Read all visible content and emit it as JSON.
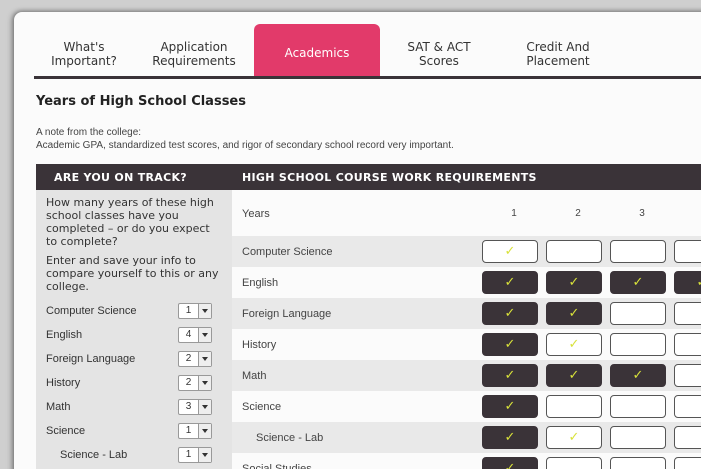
{
  "tabs": [
    {
      "label": "What's\nImportant?",
      "active": false
    },
    {
      "label": "Application\nRequirements",
      "active": false
    },
    {
      "label": "Academics",
      "active": true
    },
    {
      "label": "SAT & ACT\nScores",
      "active": false
    },
    {
      "label": "Credit And\nPlacement",
      "active": false
    }
  ],
  "section_title": "Years of High School Classes",
  "note": {
    "heading": "A note from the college:",
    "text": "Academic GPA, standardized test scores, and rigor of secondary school record very important."
  },
  "header": {
    "left": "ARE YOU ON TRACK?",
    "right": "HIGH SCHOOL COURSE WORK REQUIREMENTS"
  },
  "left_panel": {
    "question": "How many years of these high school classes have you completed – or do you expect to complete?",
    "enter": "Enter and save your info to compare yourself to this or any college.",
    "subjects": [
      {
        "label": "Computer Science",
        "value": "1"
      },
      {
        "label": "English",
        "value": "4"
      },
      {
        "label": "Foreign Language",
        "value": "2"
      },
      {
        "label": "History",
        "value": "2"
      },
      {
        "label": "Math",
        "value": "3"
      },
      {
        "label": "Science",
        "value": "1"
      },
      {
        "label": "Science - Lab",
        "value": "1"
      }
    ]
  },
  "grid": {
    "years_label": "Years",
    "year_numbers": [
      "1",
      "2",
      "3"
    ],
    "rows": [
      {
        "label": "Computer Science",
        "cells": [
          "empty-check",
          "empty",
          "empty",
          "empty"
        ]
      },
      {
        "label": "English",
        "cells": [
          "filled",
          "filled",
          "filled",
          "filled"
        ]
      },
      {
        "label": "Foreign Language",
        "cells": [
          "filled",
          "filled",
          "empty",
          "empty"
        ]
      },
      {
        "label": "History",
        "cells": [
          "filled",
          "empty-check",
          "empty",
          "empty"
        ]
      },
      {
        "label": "Math",
        "cells": [
          "filled",
          "filled",
          "filled",
          "empty"
        ]
      },
      {
        "label": "Science",
        "cells": [
          "filled",
          "empty",
          "empty",
          "empty"
        ]
      },
      {
        "label": "Science - Lab",
        "cells": [
          "filled",
          "empty-check",
          "empty",
          "empty"
        ]
      },
      {
        "label": "Social Studies",
        "cells": [
          "filled",
          "empty",
          "empty",
          "empty"
        ]
      }
    ],
    "check_glyph": "✓"
  },
  "colors": {
    "accent": "#e23a6a",
    "dark": "#3a3338",
    "check": "#d8e23a"
  }
}
